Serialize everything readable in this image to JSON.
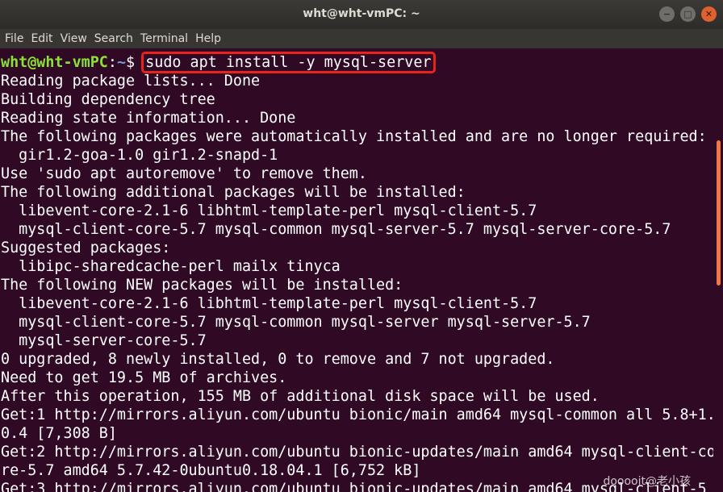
{
  "window": {
    "title": "wht@wht-vmPC: ~",
    "controls": [
      "minimize",
      "maximize",
      "close"
    ]
  },
  "menu": [
    "File",
    "Edit",
    "View",
    "Search",
    "Terminal",
    "Help"
  ],
  "prompt": {
    "user_host": "wht@wht-vmPC",
    "separator": ":",
    "path": "~",
    "symbol": "$ ",
    "command": "sudo apt install -y mysql-server"
  },
  "output": [
    "Reading package lists... Done",
    "Building dependency tree",
    "Reading state information... Done",
    "The following packages were automatically installed and are no longer required:",
    "  gir1.2-goa-1.0 gir1.2-snapd-1",
    "Use 'sudo apt autoremove' to remove them.",
    "The following additional packages will be installed:",
    "  libevent-core-2.1-6 libhtml-template-perl mysql-client-5.7",
    "  mysql-client-core-5.7 mysql-common mysql-server-5.7 mysql-server-core-5.7",
    "Suggested packages:",
    "  libipc-sharedcache-perl mailx tinyca",
    "The following NEW packages will be installed:",
    "  libevent-core-2.1-6 libhtml-template-perl mysql-client-5.7",
    "  mysql-client-core-5.7 mysql-common mysql-server mysql-server-5.7",
    "  mysql-server-core-5.7",
    "0 upgraded, 8 newly installed, 0 to remove and 7 not upgraded.",
    "Need to get 19.5 MB of archives.",
    "After this operation, 155 MB of additional disk space will be used.",
    "Get:1 http://mirrors.aliyun.com/ubuntu bionic/main amd64 mysql-common all 5.8+1.",
    "0.4 [7,308 B]",
    "Get:2 http://mirrors.aliyun.com/ubuntu bionic-updates/main amd64 mysql-client-co",
    "re-5.7 amd64 5.7.42-0ubuntu0.18.04.1 [6,752 kB]",
    "Get:3 http://mirrors.aliyun.com/ubuntu bionic-updates/main amd64 mysql-client-5"
  ],
  "watermark": "dooooit@老小孩",
  "colors": {
    "background": "#300a24",
    "prompt_user": "#8ae234",
    "prompt_path": "#729fcf",
    "highlight_box": "#e8231b",
    "scroll_thumb": "#f07746"
  }
}
